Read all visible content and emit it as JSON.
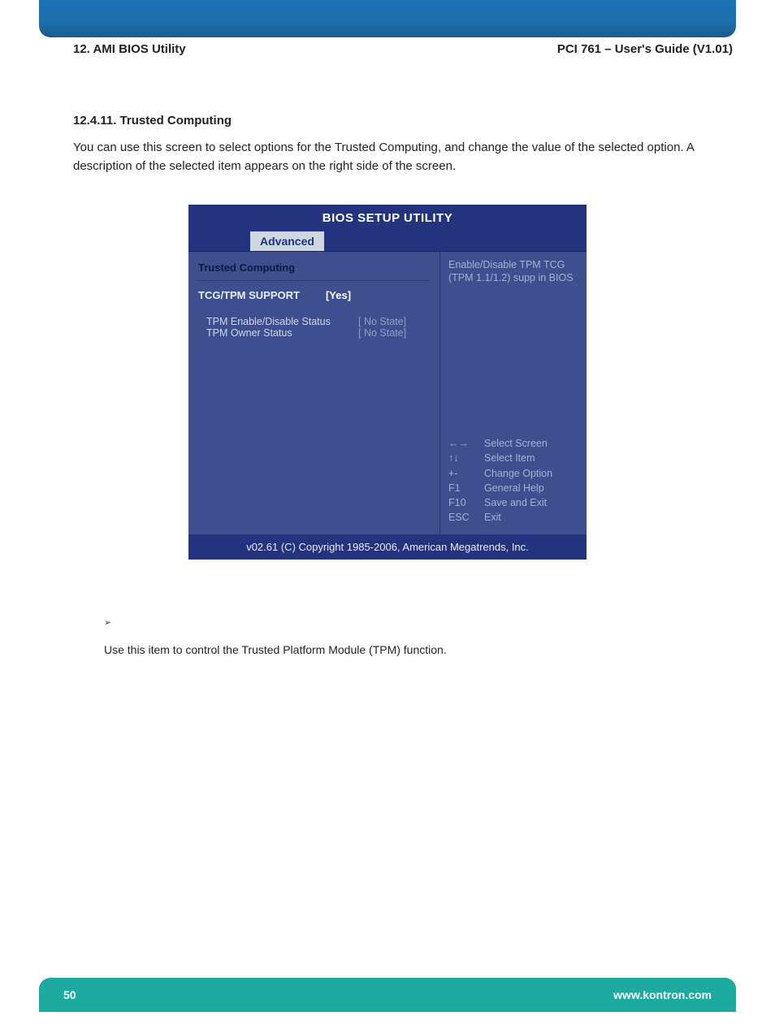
{
  "header": {
    "left": "12. AMI BIOS Utility",
    "right": "PCI 761 – User's Guide (V1.01)"
  },
  "section": {
    "title": "12.4.11. Trusted Computing",
    "body": "You can use this screen to select options for the Trusted Computing, and change the value of the selected option. A description of the selected item appears on the right side of the screen."
  },
  "bios": {
    "title": "BIOS SETUP UTILITY",
    "tab": "Advanced",
    "heading": "Trusted Computing",
    "option": {
      "label": "TCG/TPM SUPPORT",
      "value": "[Yes]"
    },
    "status": [
      {
        "label": "TPM Enable/Disable Status",
        "value": "[ No State]"
      },
      {
        "label": "TPM  Owner Status",
        "value": "[ No State]"
      }
    ],
    "desc": "Enable/Disable TPM TCG (TPM 1.1/1.2) supp in BIOS",
    "keys": [
      {
        "k": "←→",
        "d": "Select Screen"
      },
      {
        "k": "↑↓",
        "d": "Select Item"
      },
      {
        "k": "+-",
        "d": "Change Option"
      },
      {
        "k": "F1",
        "d": "General Help"
      },
      {
        "k": "F10",
        "d": "Save and Exit"
      },
      {
        "k": "ESC",
        "d": "Exit"
      }
    ],
    "footer": "v02.61 (C) Copyright 1985-2006, American Megatrends, Inc."
  },
  "note": {
    "bullet": "➢",
    "text": "Use this item to control the Trusted Platform Module (TPM) function."
  },
  "footer": {
    "page": "50",
    "url": "www.kontron.com"
  }
}
